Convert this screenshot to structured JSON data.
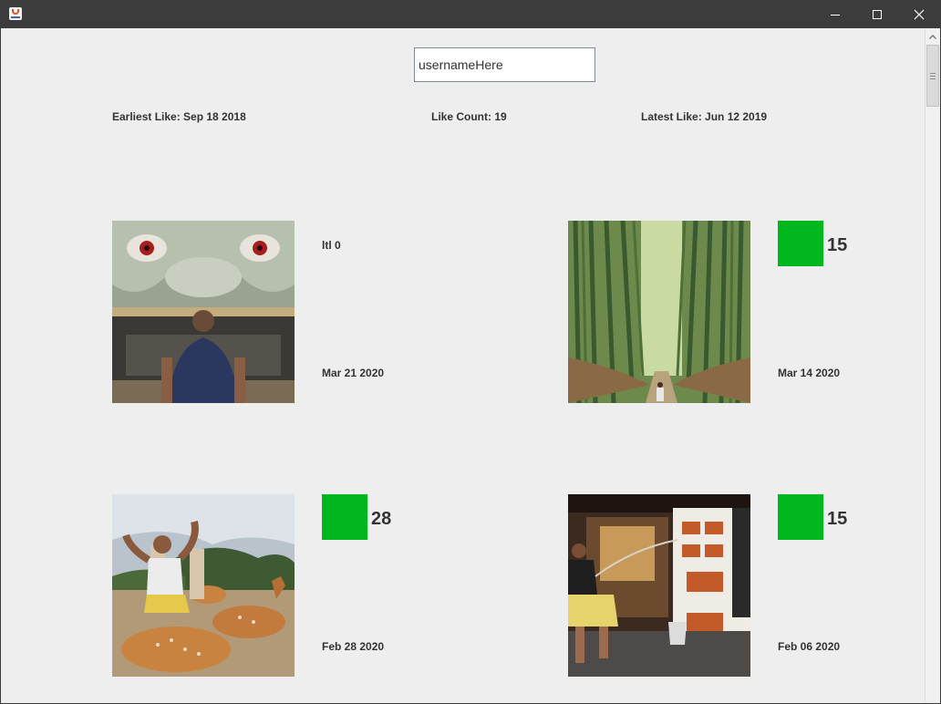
{
  "search": {
    "value": "usernameHere"
  },
  "stats": {
    "earliest_like": "Earliest Like: Sep 18 2018",
    "like_count": "Like Count: 19",
    "latest_like": "Latest Like: Jun 12 2019"
  },
  "posts": [
    {
      "label": "ltl 0",
      "date": "Mar 21 2020",
      "photo": "shrine-guardian-statue"
    },
    {
      "likes": "15",
      "date": "Mar 14 2020",
      "photo": "bamboo-forest-path",
      "swatch_color": "#00b81e"
    },
    {
      "likes": "28",
      "date": "Feb 28 2020",
      "photo": "man-with-deer-in-park",
      "swatch_color": "#00b81e"
    },
    {
      "likes": "15",
      "date": "Feb 06 2020",
      "photo": "street-food-stall",
      "swatch_color": "#00b81e"
    }
  ],
  "colors": {
    "titlebar": "#3c3c3c",
    "background": "#eeeeee",
    "like_swatch": "#00b81e",
    "text": "#333333"
  }
}
